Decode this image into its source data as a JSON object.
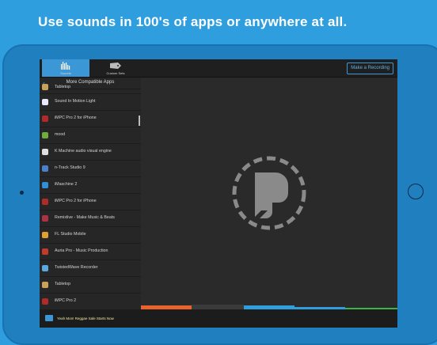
{
  "headline": "Use sounds in 100's of apps or anywhere at all.",
  "tabs": [
    {
      "label": "Sounds",
      "icon": "sounds-waveform-icon",
      "selected": true
    },
    {
      "label": "Custom Sets",
      "icon": "custom-sets-tag-icon",
      "selected": false
    }
  ],
  "record_button": "Make a Recording",
  "sidebar": {
    "title": "More Compatible Apps",
    "items": [
      {
        "label": "Tabletop",
        "color": "#c9a25a"
      },
      {
        "label": "Sound In Motion Light",
        "color": "#e8e8ff"
      },
      {
        "label": "iMPC Pro 2 for iPhone",
        "color": "#b02a2a"
      },
      {
        "label": "mood",
        "color": "#6fae3a"
      },
      {
        "label": "K Machine audio visual engine",
        "color": "#e0e0e0"
      },
      {
        "label": "n-Track Studio 9",
        "color": "#4a7fcc"
      },
      {
        "label": "iMaschine 2",
        "color": "#2f8fd8"
      },
      {
        "label": "iMPC Pro 2 for iPhone",
        "color": "#b02a2a"
      },
      {
        "label": "Remixlive - Make Music & Beats",
        "color": "#aa3344"
      },
      {
        "label": "FL Studio Mobile",
        "color": "#e0a030"
      },
      {
        "label": "Auria Pro - Music Production",
        "color": "#c23a2a"
      },
      {
        "label": "TwistedWave Recorder",
        "color": "#5aa8e0"
      },
      {
        "label": "Tabletop",
        "color": "#c9a25a"
      },
      {
        "label": "iMPC Pro 2",
        "color": "#b02a2a"
      }
    ]
  },
  "footer_ticker": "Yeah Mon! Reggae Sale Starts Now",
  "colors": {
    "accent": "#3b97d6",
    "background": "#2e9ede",
    "screen": "#2a2a2a"
  }
}
